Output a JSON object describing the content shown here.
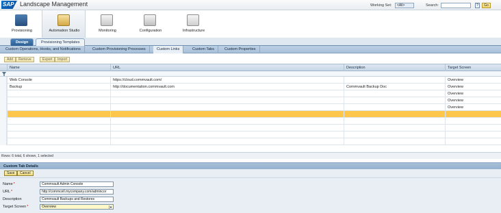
{
  "header": {
    "logo": "SAP",
    "title": "Landscape Management",
    "working_set_label": "Working Set:",
    "working_set_value": "<All>",
    "search_label": "Search:",
    "search_value": "",
    "search_help": "?",
    "go": "Go"
  },
  "main_nav": [
    {
      "label": "Provisioning",
      "icon": "provisioning-icon"
    },
    {
      "label": "Automation Studio",
      "icon": "automation-studio-icon"
    },
    {
      "label": "Monitoring",
      "icon": "monitoring-icon"
    },
    {
      "label": "Configuration",
      "icon": "configuration-icon"
    },
    {
      "label": "Infrastructure",
      "icon": "infrastructure-icon"
    }
  ],
  "sub_tabs": [
    "Design",
    "Provisioning Templates"
  ],
  "third_tabs": [
    "Custom Operations, Hooks, and Notifications",
    "Custom Provisioning Processes",
    "Custom Links",
    "Custom Tabs",
    "Custom Properties"
  ],
  "toolbar": {
    "add": "Add",
    "remove": "Remove",
    "export": "Export",
    "import": "Import"
  },
  "table": {
    "columns": [
      "Name",
      "URL",
      "Description",
      "Target Screen"
    ],
    "rows": [
      [
        "Web Console",
        "https://cloud.commvault.com/",
        "",
        "Overview"
      ],
      [
        "Backup",
        "http://documentation.commvault.com",
        "Commvault Backup Doc",
        "Overview"
      ],
      [
        "",
        "",
        "",
        "Overview"
      ],
      [
        "",
        "",
        "",
        "Overview"
      ],
      [
        "",
        "",
        "",
        "Overview"
      ],
      [
        "",
        "",
        "",
        ""
      ],
      [
        "",
        "",
        "",
        ""
      ],
      [
        "",
        "",
        "",
        ""
      ],
      [
        "",
        "",
        "",
        ""
      ],
      [
        "",
        "",
        "",
        ""
      ]
    ],
    "selected_row_index": 5,
    "footer": "Rows: 6 total, 6 shown, 1 selected"
  },
  "details": {
    "title": "Custom Tab Details",
    "save": "Save",
    "cancel": "Cancel",
    "fields": [
      {
        "label": "Name",
        "required": "*",
        "value": "Commvault Admin Console"
      },
      {
        "label": "URL",
        "required": "*",
        "value": "http://commcell.mycompany.com/admincor"
      },
      {
        "label": "Description",
        "required": "",
        "value": "Commvault Backups and Restores"
      },
      {
        "label": "Target Screen",
        "required": "*",
        "value": "Overview"
      }
    ]
  }
}
